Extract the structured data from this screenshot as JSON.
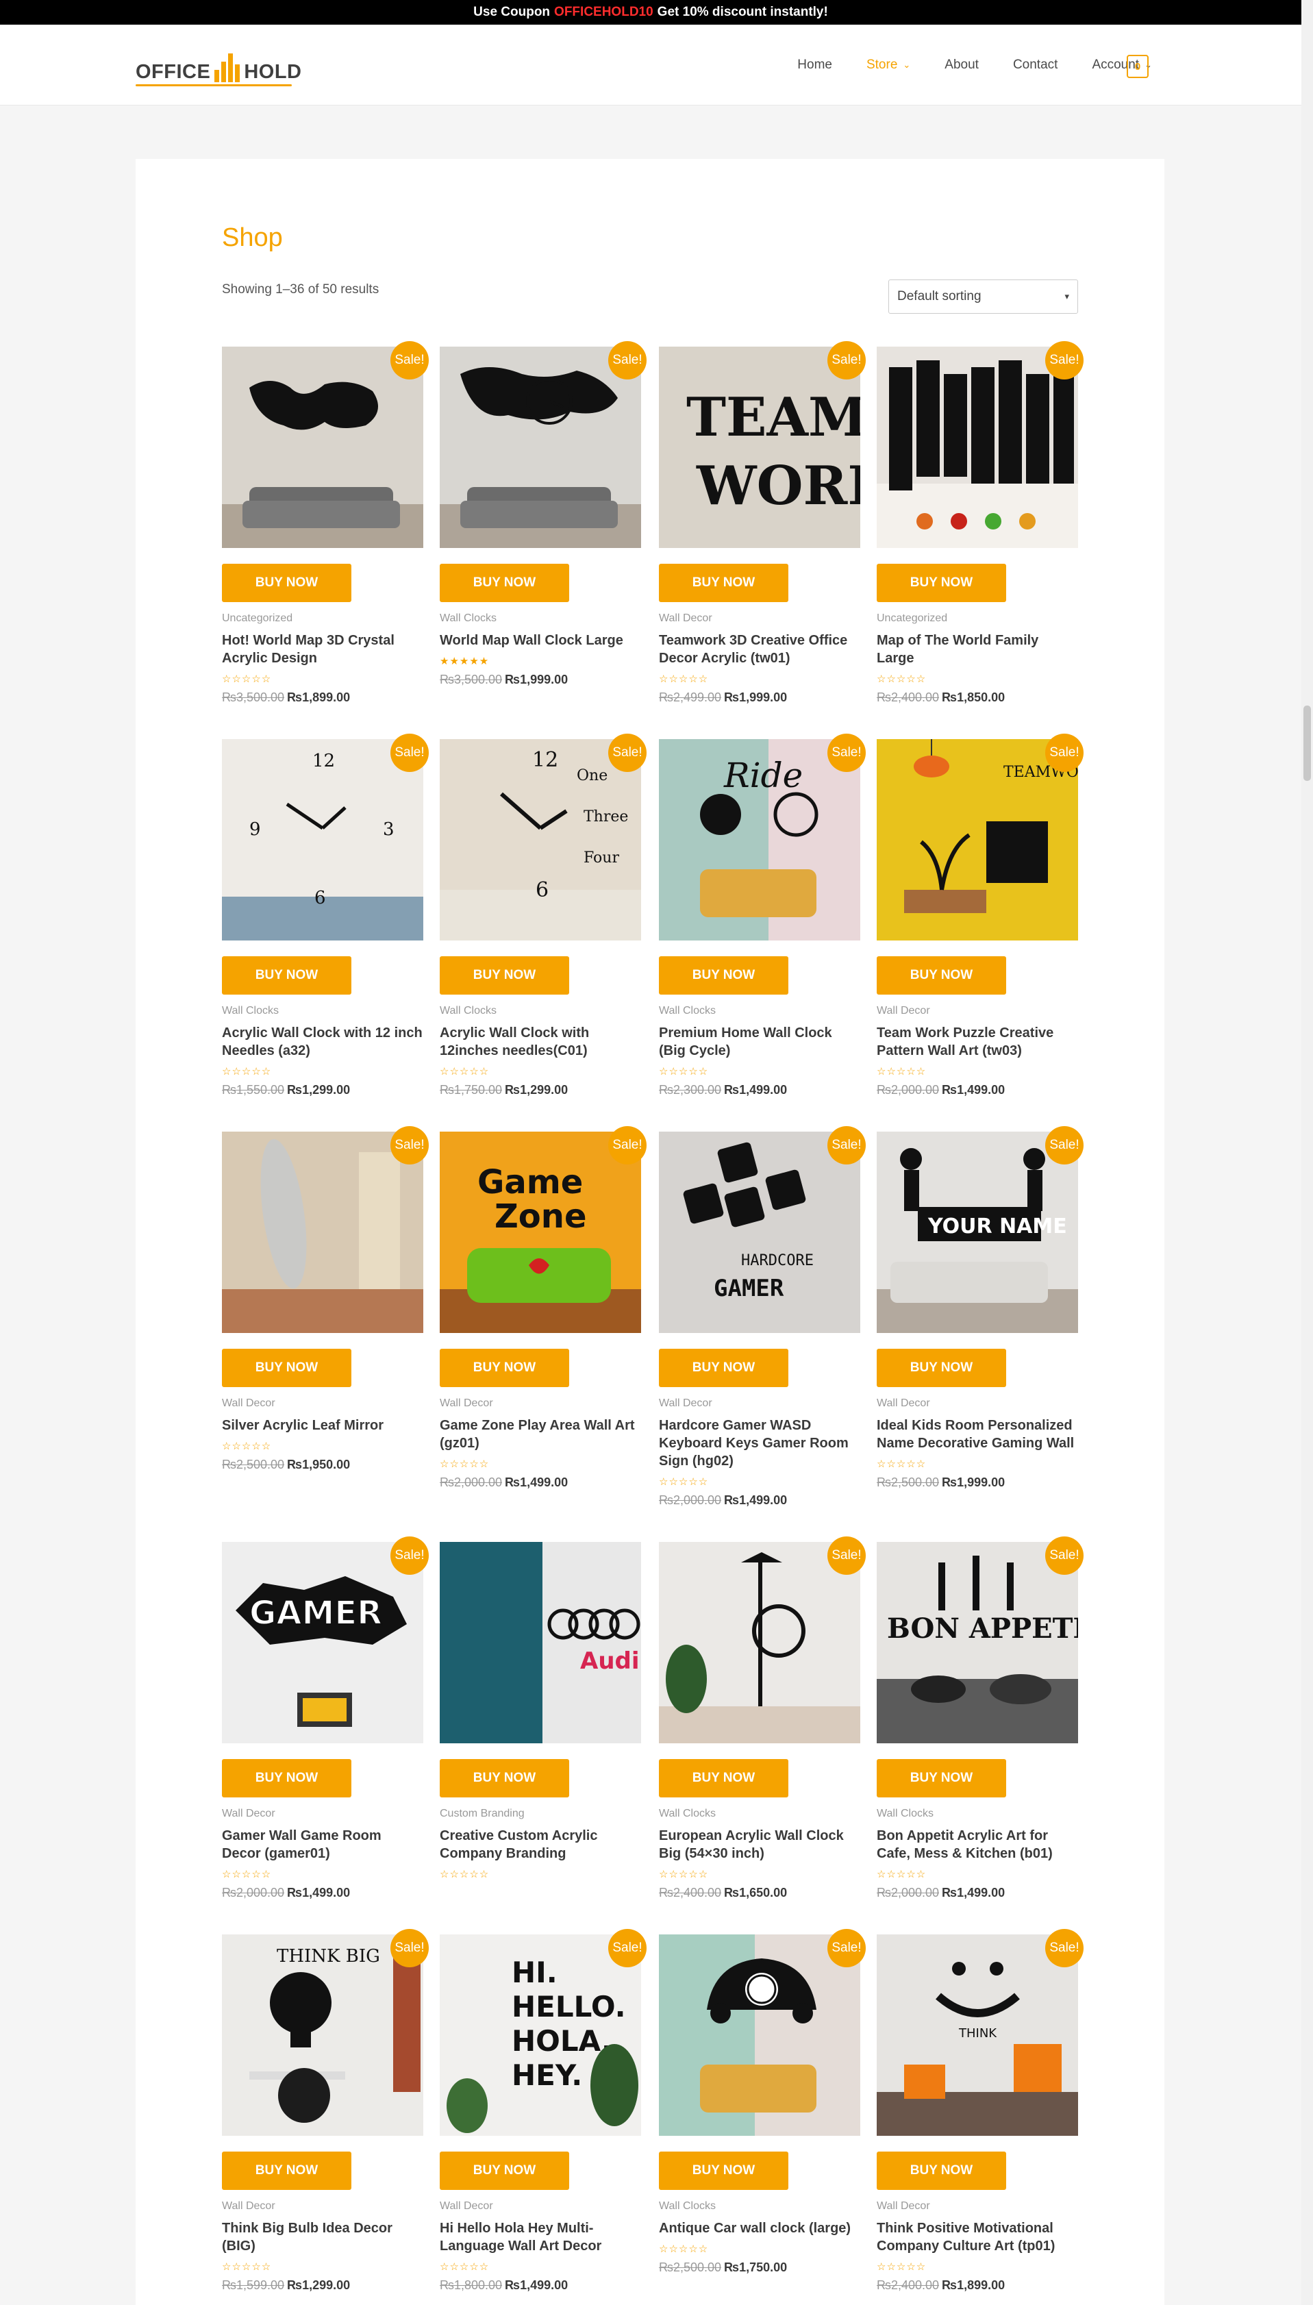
{
  "topbar": {
    "prefix": "Use Coupon",
    "code": "OFFICEHOLD10",
    "suffix": "Get 10% discount instantly!"
  },
  "logo": {
    "word1": "OFFICE",
    "word2": "HOLD"
  },
  "nav": {
    "items": [
      {
        "label": "Home"
      },
      {
        "label": "Store",
        "dropdown": true,
        "active": true
      },
      {
        "label": "About"
      },
      {
        "label": "Contact"
      },
      {
        "label": "Account",
        "dropdown": true
      }
    ],
    "cart_count": "0"
  },
  "shop": {
    "title": "Shop",
    "results": "Showing 1–36 of 50 results",
    "sorting": "Default sorting",
    "sale_label": "Sale!",
    "buy_label": "BUY NOW"
  },
  "colors": {
    "accent": "#f5a300",
    "coupon": "#ff2d2d"
  },
  "products": [
    {
      "cat": "Uncategorized",
      "title": "Hot! World Map 3D Crystal Acrylic Design",
      "old": "₨3,500.00",
      "price": "₨1,899.00",
      "sale": true,
      "rating": 0,
      "bg": "#d9d4cc",
      "motif": "map"
    },
    {
      "cat": "Wall Clocks",
      "title": "World Map Wall Clock Large",
      "old": "₨3,500.00",
      "price": "₨1,999.00",
      "sale": true,
      "rating": 5,
      "bg": "#d8d6d1",
      "motif": "mapclock"
    },
    {
      "cat": "Wall Decor",
      "title": "Teamwork 3D Creative Office Decor Acrylic (tw01)",
      "old": "₨2,499.00",
      "price": "₨1,999.00",
      "sale": true,
      "rating": 0,
      "bg": "#d9d3c9",
      "motif": "team"
    },
    {
      "cat": "Uncategorized",
      "title": "Map of The World Family Large",
      "old": "₨2,400.00",
      "price": "₨1,850.00",
      "sale": true,
      "rating": 0,
      "bg": "#e7e3de",
      "motif": "family"
    },
    {
      "cat": "Wall Clocks",
      "title": "Acrylic Wall Clock with 12 inch Needles (a32)",
      "old": "₨1,550.00",
      "price": "₨1,299.00",
      "sale": true,
      "rating": 0,
      "bg": "#eeebe6",
      "motif": "clock"
    },
    {
      "cat": "Wall Clocks",
      "title": "Acrylic Wall Clock with 12inches needles(C01)",
      "old": "₨1,750.00",
      "price": "₨1,299.00",
      "sale": true,
      "rating": 0,
      "bg": "#e4dccf",
      "motif": "clock2"
    },
    {
      "cat": "Wall Clocks",
      "title": "Premium Home Wall Clock (Big Cycle)",
      "old": "₨2,300.00",
      "price": "₨1,499.00",
      "sale": true,
      "rating": 0,
      "bg": "#e9d7d9",
      "motif": "cycle"
    },
    {
      "cat": "Wall Decor",
      "title": "Team Work Puzzle Creative Pattern Wall Art (tw03)",
      "old": "₨2,000.00",
      "price": "₨1,499.00",
      "sale": true,
      "rating": 0,
      "bg": "#e8c21c",
      "motif": "puzzle"
    },
    {
      "cat": "Wall Decor",
      "title": "Silver Acrylic Leaf Mirror",
      "old": "₨2,500.00",
      "price": "₨1,950.00",
      "sale": true,
      "rating": 0,
      "bg": "#d8c9b3",
      "motif": "leaf"
    },
    {
      "cat": "Wall Decor",
      "title": "Game Zone Play Area Wall Art (gz01)",
      "old": "₨2,000.00",
      "price": "₨1,499.00",
      "sale": true,
      "rating": 0,
      "bg": "#f0a21b",
      "motif": "game"
    },
    {
      "cat": "Wall Decor",
      "title": "Hardcore Gamer WASD Keyboard Keys Gamer Room Sign (hg02)",
      "old": "₨2,000.00",
      "price": "₨1,499.00",
      "sale": true,
      "rating": 0,
      "bg": "#d6d3d0",
      "motif": "wasd"
    },
    {
      "cat": "Wall Decor",
      "title": "Ideal Kids Room Personalized Name Decorative Gaming Wall",
      "old": "₨2,500.00",
      "price": "₨1,999.00",
      "sale": true,
      "rating": 0,
      "bg": "#e3e1de",
      "motif": "name"
    },
    {
      "cat": "Wall Decor",
      "title": "Gamer Wall Game Room Decor (gamer01)",
      "old": "₨2,000.00",
      "price": "₨1,499.00",
      "sale": true,
      "rating": 0,
      "bg": "#eeeeee",
      "motif": "gamer"
    },
    {
      "cat": "Custom Branding",
      "title": "Creative Custom Acrylic Company Branding",
      "old": "",
      "price": "",
      "sale": false,
      "rating": 0,
      "bg": "#1f6f80",
      "motif": "audi"
    },
    {
      "cat": "Wall Clocks",
      "title": "European Acrylic Wall Clock Big (54×30 inch)",
      "old": "₨2,400.00",
      "price": "₨1,650.00",
      "sale": true,
      "rating": 0,
      "bg": "#ebe9e6",
      "motif": "lamp"
    },
    {
      "cat": "Wall Clocks",
      "title": "Bon Appetit Acrylic Art for Cafe, Mess & Kitchen (b01)",
      "old": "₨2,000.00",
      "price": "₨1,499.00",
      "sale": true,
      "rating": 0,
      "bg": "#e6e4e1",
      "motif": "bon"
    },
    {
      "cat": "Wall Decor",
      "title": "Think Big Bulb Idea Decor (BIG)",
      "old": "₨1,599.00",
      "price": "₨1,299.00",
      "sale": true,
      "rating": 0,
      "bg": "#ecebe8",
      "motif": "bulb"
    },
    {
      "cat": "Wall Decor",
      "title": "Hi Hello Hola Hey Multi-Language Wall Art Decor",
      "old": "₨1,800.00",
      "price": "₨1,499.00",
      "sale": true,
      "rating": 0,
      "bg": "#f1f0ee",
      "motif": "hello"
    },
    {
      "cat": "Wall Clocks",
      "title": "Antique Car wall clock (large)",
      "old": "₨2,500.00",
      "price": "₨1,750.00",
      "sale": true,
      "rating": 0,
      "bg": "#e4dcd7",
      "motif": "car"
    },
    {
      "cat": "Wall Decor",
      "title": "Think Positive Motivational Company Culture Art (tp01)",
      "old": "₨2,400.00",
      "price": "₨1,899.00",
      "sale": true,
      "rating": 0,
      "bg": "#e6e4e1",
      "motif": "smile"
    }
  ]
}
